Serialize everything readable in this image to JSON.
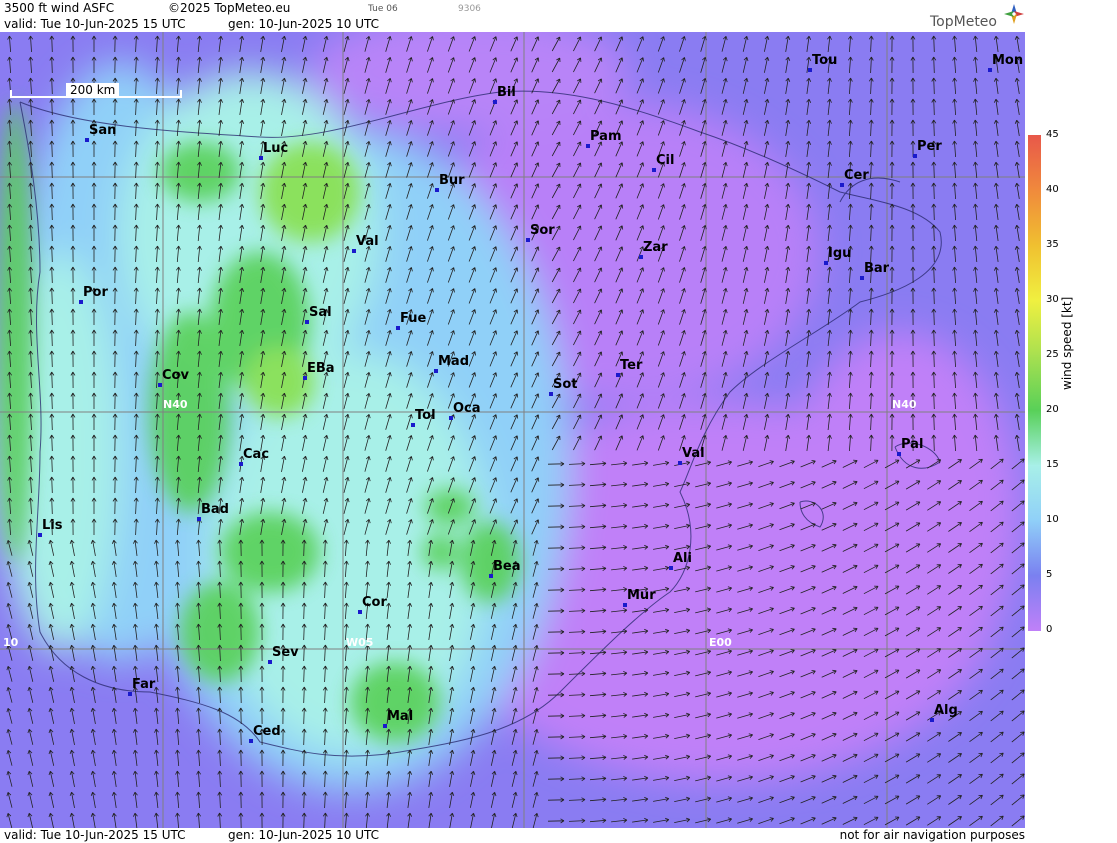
{
  "header": {
    "product": "3500 ft wind ASFC",
    "copyright": "©2025 TopMeteo.eu",
    "small_day": "Tue 06",
    "small_code": "9306",
    "valid": "valid:  Tue  10-Jun-2025  15 UTC",
    "gen": "gen: 10-Jun-2025 10 UTC",
    "logo": "TopMeteo"
  },
  "footer": {
    "valid": "valid:  Tue  10-Jun-2025  15 UTC",
    "gen": "gen: 10-Jun-2025 10 UTC",
    "disclaimer": "not for air navigation purposes"
  },
  "scale": {
    "label": "200 km"
  },
  "grid_labels": {
    "n40": "N40",
    "n40_east": "N40",
    "w05": "W05",
    "e00": "E00",
    "w10": "10"
  },
  "cities": [
    {
      "name": "San"
    },
    {
      "name": "Luc"
    },
    {
      "name": "Bil"
    },
    {
      "name": "Tou"
    },
    {
      "name": "Mon"
    },
    {
      "name": "Pam"
    },
    {
      "name": "Per"
    },
    {
      "name": "Cil"
    },
    {
      "name": "Bur"
    },
    {
      "name": "Cer"
    },
    {
      "name": "Sor"
    },
    {
      "name": "Val"
    },
    {
      "name": "Zar"
    },
    {
      "name": "Igu"
    },
    {
      "name": "Bar"
    },
    {
      "name": "Por"
    },
    {
      "name": "Sal"
    },
    {
      "name": "Fue"
    },
    {
      "name": "Cov"
    },
    {
      "name": "EBa"
    },
    {
      "name": "Mad"
    },
    {
      "name": "Ter"
    },
    {
      "name": "Sot"
    },
    {
      "name": "Tol"
    },
    {
      "name": "Oca"
    },
    {
      "name": "Pal"
    },
    {
      "name": "Cac"
    },
    {
      "name": "Val"
    },
    {
      "name": "Bad"
    },
    {
      "name": "Lis"
    },
    {
      "name": "Ali"
    },
    {
      "name": "Bea"
    },
    {
      "name": "Mur"
    },
    {
      "name": "Cor"
    },
    {
      "name": "Sev"
    },
    {
      "name": "Far"
    },
    {
      "name": "Mal"
    },
    {
      "name": "Alg"
    },
    {
      "name": "Ced"
    }
  ],
  "legend": {
    "title": "wind speed [kt]",
    "ticks": [
      "45",
      "40",
      "35",
      "30",
      "25",
      "20",
      "15",
      "10",
      "5",
      "0"
    ],
    "colors": [
      "#e8584a",
      "#f08a3c",
      "#f0c030",
      "#f0f040",
      "#a8e050",
      "#58d058",
      "#a8f0e8",
      "#90d0f8",
      "#7a80f0",
      "#c080f8"
    ]
  }
}
